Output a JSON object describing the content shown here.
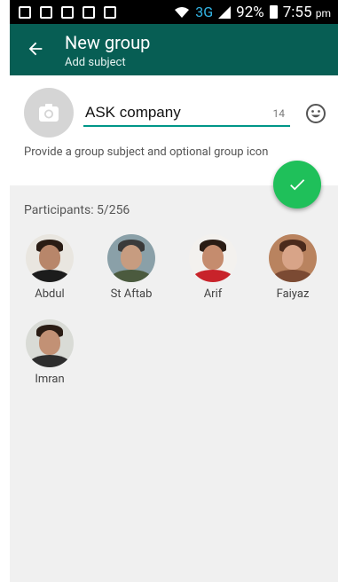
{
  "status_bar": {
    "network": "3G",
    "battery": "92%",
    "time": "7:55",
    "time_suffix": "pm"
  },
  "app_bar": {
    "title": "New group",
    "subtitle": "Add subject"
  },
  "subject": {
    "value": "ASK company",
    "char_count": "14",
    "helper_text": "Provide a group subject and optional group icon"
  },
  "participants": {
    "label": "Participants: 5/256",
    "items": [
      {
        "name": "Abdul"
      },
      {
        "name": "St Aftab"
      },
      {
        "name": "Arif"
      },
      {
        "name": "Faiyaz"
      },
      {
        "name": "Imran"
      }
    ]
  },
  "colors": {
    "app_bar": "#075e54",
    "accent": "#009688",
    "fab": "#1fc05a"
  },
  "icons": [
    "back-arrow-icon",
    "camera-icon",
    "emoji-icon",
    "check-icon",
    "wifi-icon",
    "signal-icon",
    "battery-icon"
  ]
}
